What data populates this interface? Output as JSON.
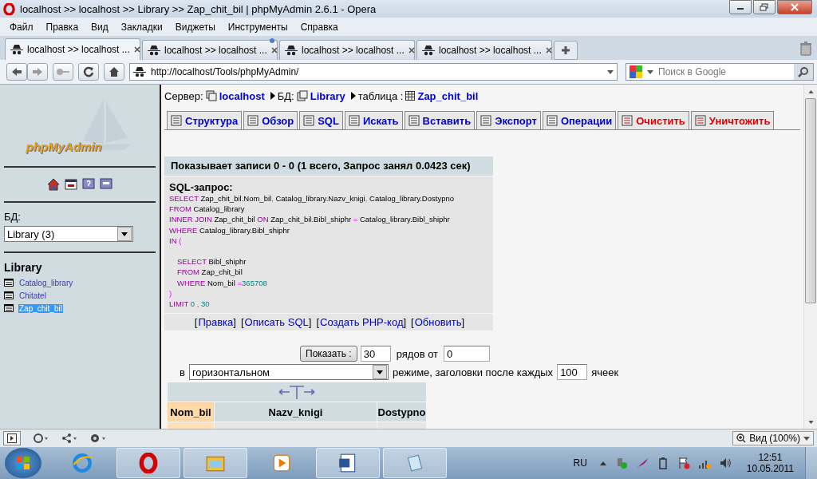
{
  "window": {
    "title": "localhost >> localhost >> Library >> Zap_chit_bil | phpMyAdmin 2.6.1 - Opera"
  },
  "menu": [
    "Файл",
    "Правка",
    "Вид",
    "Закладки",
    "Виджеты",
    "Инструменты",
    "Справка"
  ],
  "tabs": [
    {
      "label": "localhost >> localhost ...",
      "selected": true,
      "unread": false
    },
    {
      "label": "localhost >> localhost ...",
      "selected": false,
      "unread": true
    },
    {
      "label": "localhost >> localhost ...",
      "selected": false,
      "unread": false
    },
    {
      "label": "localhost >> localhost ...",
      "selected": false,
      "unread": false
    }
  ],
  "address": {
    "value": "http://localhost/Tools/phpMyAdmin/"
  },
  "search": {
    "placeholder": "Поиск в Google"
  },
  "sidebar": {
    "logo": "phpMyAdmin",
    "db_label": "БД:",
    "db_select": "Library (3)",
    "db_title": "Library",
    "tables": [
      {
        "name": "Catalog_library",
        "selected": false
      },
      {
        "name": "Chitatel",
        "selected": false
      },
      {
        "name": "Zap_chit_bil",
        "selected": true
      }
    ]
  },
  "breadcrumb": {
    "server_label": "Сервер:",
    "server": "localhost",
    "db_label": "БД:",
    "db": "Library",
    "table_label": "таблица :",
    "table": "Zap_chit_bil"
  },
  "action_tabs": [
    {
      "label": "Структура",
      "danger": false
    },
    {
      "label": "Обзор",
      "danger": false
    },
    {
      "label": "SQL",
      "danger": false
    },
    {
      "label": "Искать",
      "danger": false
    },
    {
      "label": "Вставить",
      "danger": false
    },
    {
      "label": "Экспорт",
      "danger": false
    },
    {
      "label": "Операции",
      "danger": false
    },
    {
      "label": "Очистить",
      "danger": true
    },
    {
      "label": "Уничтожить",
      "danger": true
    }
  ],
  "result": {
    "header": "Показывает записи 0 - 0 (1 всего, Запрос занял 0.0423 сек)",
    "sql_label": "SQL-запрос:",
    "sql_lines": [
      {
        "indented": false,
        "gap_before": false,
        "tokens": [
          {
            "kind": "kw",
            "text": "SELECT "
          },
          {
            "kind": "id",
            "text": "Zap_chit_bil.Nom_bil"
          },
          {
            "kind": "op",
            "text": ", "
          },
          {
            "kind": "id",
            "text": "Catalog_library.Nazv_knigi"
          },
          {
            "kind": "op",
            "text": ", "
          },
          {
            "kind": "id",
            "text": "Catalog_library.Dostypno"
          }
        ]
      },
      {
        "indented": false,
        "gap_before": false,
        "tokens": [
          {
            "kind": "kw",
            "text": "FROM "
          },
          {
            "kind": "id",
            "text": "Catalog_library"
          }
        ]
      },
      {
        "indented": false,
        "gap_before": false,
        "tokens": [
          {
            "kind": "kw",
            "text": "INNER JOIN "
          },
          {
            "kind": "id",
            "text": "Zap_chit_bil "
          },
          {
            "kind": "kw",
            "text": "ON "
          },
          {
            "kind": "id",
            "text": "Zap_chit_bil.Bibl_shiphr "
          },
          {
            "kind": "op",
            "text": "= "
          },
          {
            "kind": "id",
            "text": "Catalog_library.Bibl_shiphr"
          }
        ]
      },
      {
        "indented": false,
        "gap_before": false,
        "tokens": [
          {
            "kind": "kw",
            "text": "WHERE "
          },
          {
            "kind": "id",
            "text": "Catalog_library.Bibl_shiphr"
          }
        ]
      },
      {
        "indented": false,
        "gap_before": false,
        "tokens": [
          {
            "kind": "kw",
            "text": "IN "
          },
          {
            "kind": "op",
            "text": "("
          }
        ]
      },
      {
        "indented": true,
        "gap_before": true,
        "tokens": [
          {
            "kind": "kw",
            "text": "SELECT "
          },
          {
            "kind": "id",
            "text": "Bibl_shiphr"
          }
        ]
      },
      {
        "indented": true,
        "gap_before": false,
        "tokens": [
          {
            "kind": "kw",
            "text": "FROM "
          },
          {
            "kind": "id",
            "text": "Zap_chit_bil"
          }
        ]
      },
      {
        "indented": true,
        "gap_before": false,
        "tokens": [
          {
            "kind": "kw",
            "text": "WHERE "
          },
          {
            "kind": "id",
            "text": "Nom_bil "
          },
          {
            "kind": "op",
            "text": "="
          },
          {
            "kind": "num",
            "text": "365708"
          }
        ]
      },
      {
        "indented": false,
        "gap_before": false,
        "tokens": [
          {
            "kind": "op",
            "text": ")"
          }
        ]
      },
      {
        "indented": false,
        "gap_before": false,
        "tokens": [
          {
            "kind": "kw",
            "text": "LIMIT "
          },
          {
            "kind": "num",
            "text": "0 "
          },
          {
            "kind": "op",
            "text": ", "
          },
          {
            "kind": "num",
            "text": "30"
          }
        ]
      }
    ],
    "links": [
      {
        "open": "[",
        "label": "Правка",
        "close": "]"
      },
      {
        "open": "[",
        "label": "Описать SQL",
        "close": "]"
      },
      {
        "open": "[",
        "label": "Создать PHP-код",
        "close": "]"
      },
      {
        "open": "[",
        "label": "Обновить",
        "close": "]"
      }
    ]
  },
  "display": {
    "button": "Показать :",
    "rows": "30",
    "rows_label": "рядов от",
    "from": "0",
    "in_label": "в",
    "mode": "горизонтальном",
    "mode_label": "режиме, заголовки после каждых",
    "repeat": "100",
    "repeat_label": "ячеек"
  },
  "table": {
    "columns": [
      {
        "name": "Nom_bil",
        "sorted": true
      },
      {
        "name": "Nazv_knigi",
        "sorted": false
      },
      {
        "name": "Dostypno",
        "sorted": false
      }
    ]
  },
  "status_bar": {
    "zoom": "Вид (100%)"
  },
  "taskbar": {
    "language": "RU",
    "time": "12:51",
    "date": "10.05.2011"
  }
}
